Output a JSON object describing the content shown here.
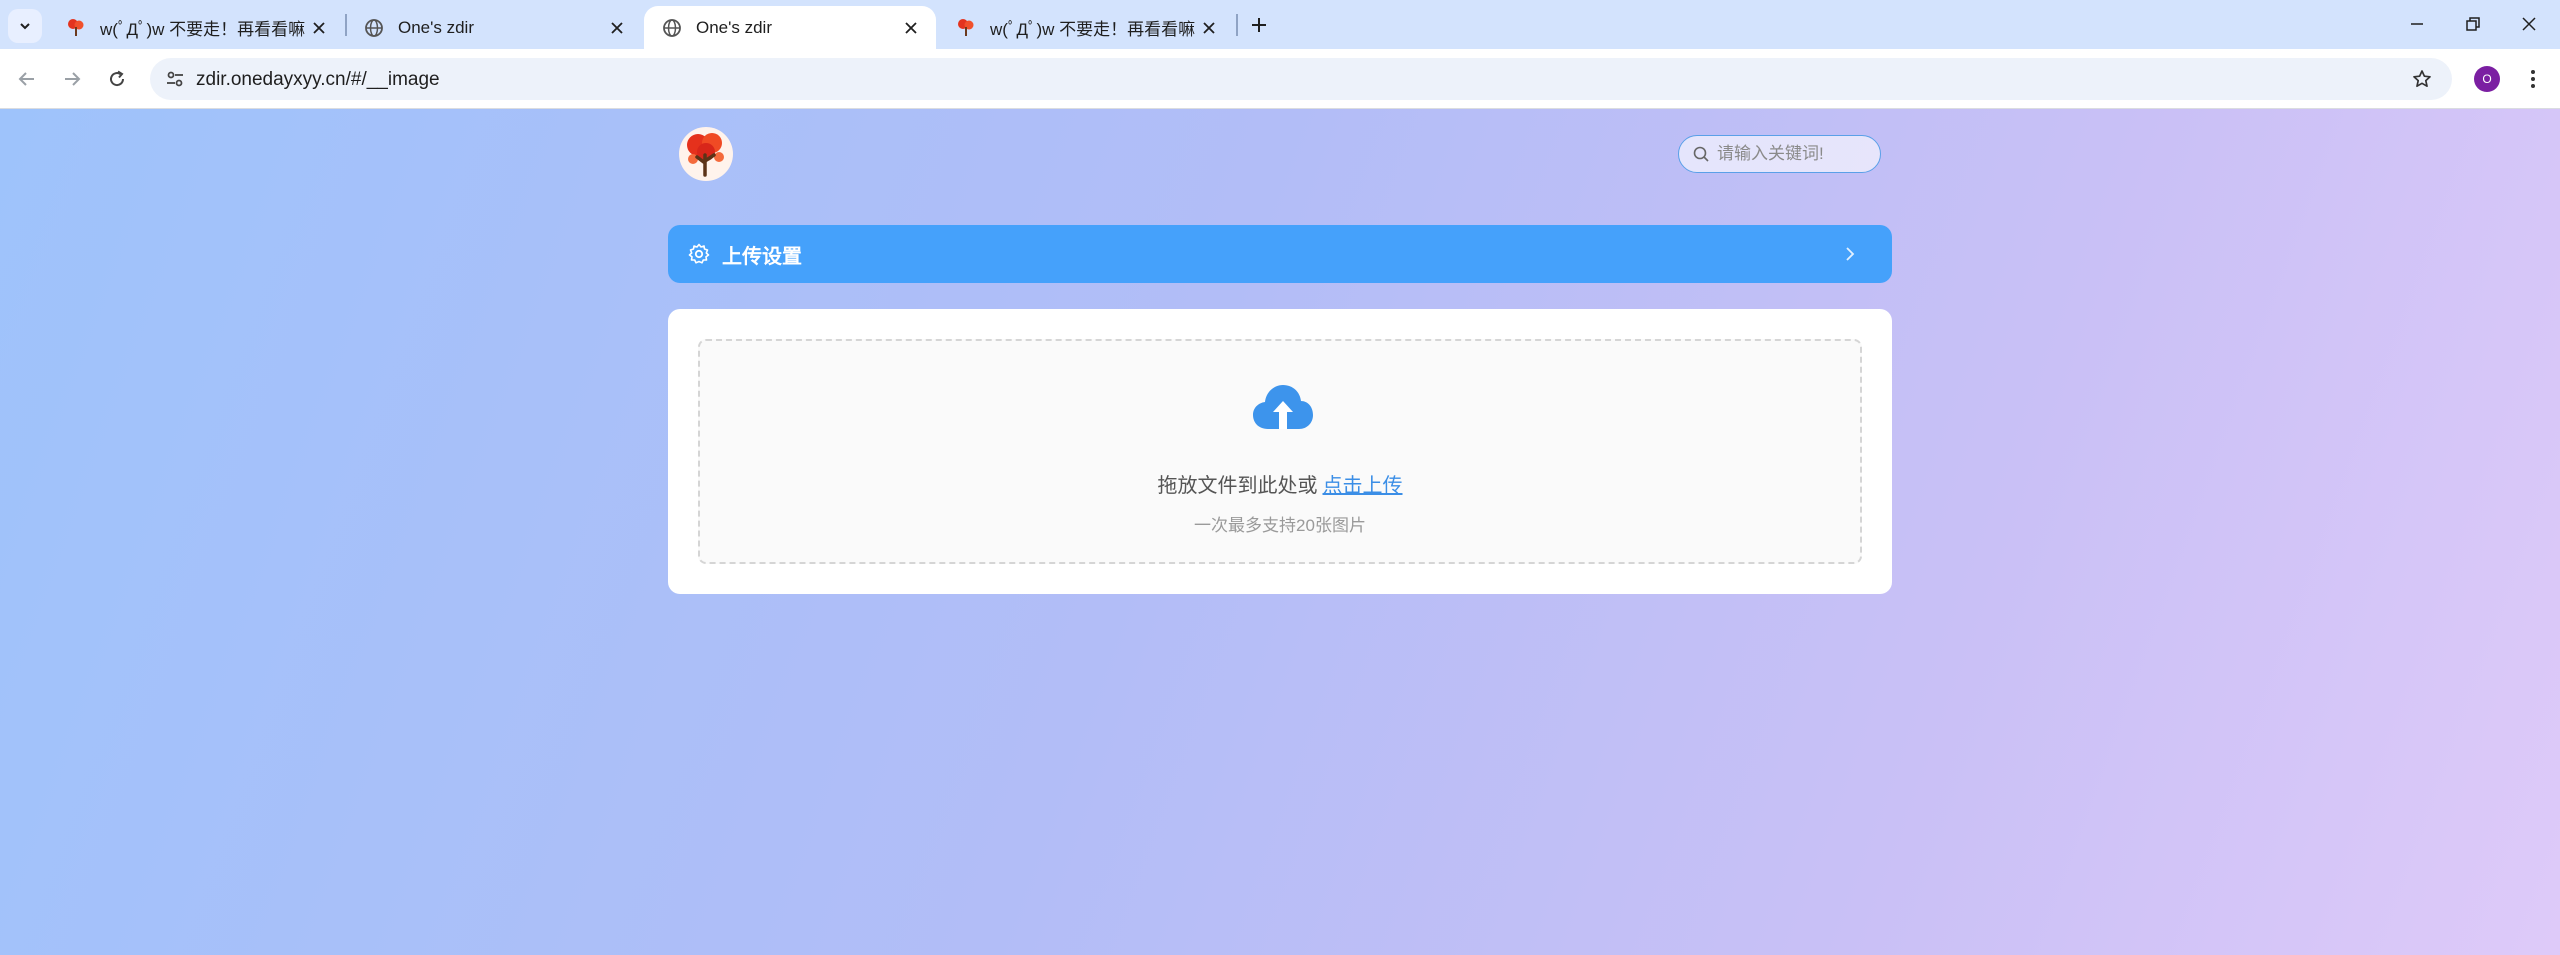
{
  "browser": {
    "tabs": [
      {
        "title": "w(ﾟДﾟ)w 不要走！再看看嘛！",
        "favicon": "tree-icon",
        "active": false
      },
      {
        "title": "One's zdir",
        "favicon": "globe-icon",
        "active": false
      },
      {
        "title": "One's zdir",
        "favicon": "globe-icon",
        "active": true
      },
      {
        "title": "w(ﾟДﾟ)w 不要走！再看看嘛！",
        "favicon": "tree-icon",
        "active": false
      }
    ],
    "url": "zdir.onedayxyy.cn/#/__image",
    "profile_initial": "O"
  },
  "page": {
    "search_placeholder": "请输入关键词!",
    "settings_label": "上传设置",
    "upload": {
      "text": "拖放文件到此处或",
      "link": "点击上传",
      "tip": "一次最多支持20张图片"
    }
  },
  "colors": {
    "accent": "#45a1fb",
    "link": "#3b8ee6",
    "tabstrip": "#d3e3fd",
    "profile": "#7b1fa2"
  }
}
